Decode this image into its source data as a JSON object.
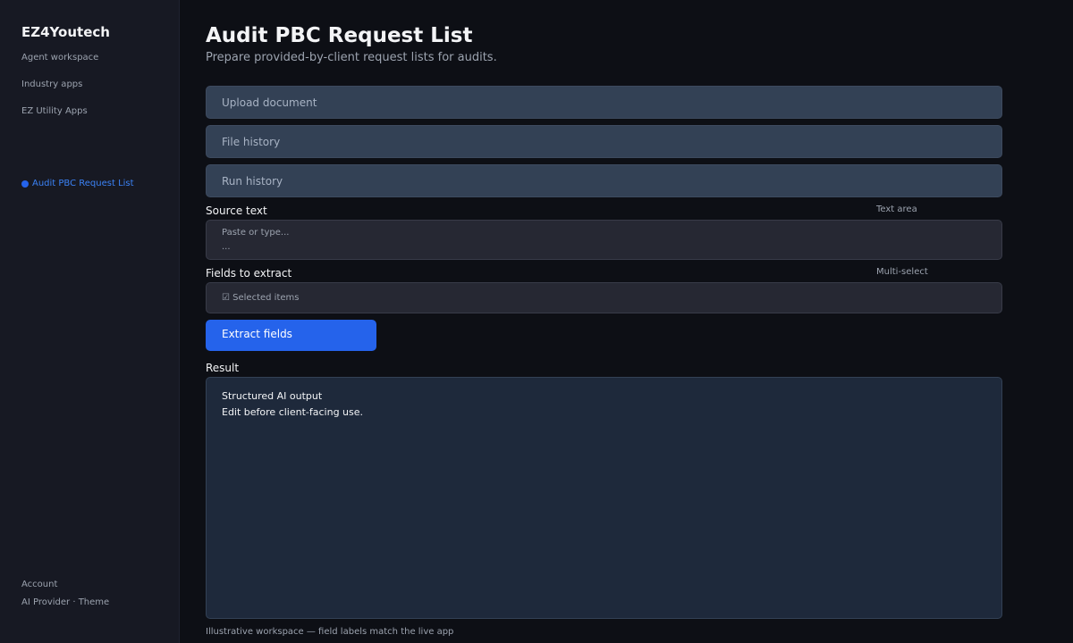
{
  "sidebar": {
    "brand": "EZ4Youtech",
    "nav": [
      {
        "label": "Agent workspace"
      },
      {
        "label": "Industry apps"
      },
      {
        "label": "EZ Utility Apps"
      }
    ],
    "active_item": "Audit PBC Request List",
    "footer": {
      "account": "Account",
      "ai_provider": "AI Provider",
      "separator": " · ",
      "theme": "Theme"
    }
  },
  "main": {
    "title": "Audit PBC Request List",
    "subtitle": "Prepare provided-by-client request lists for audits.",
    "sections": [
      {
        "label": "Upload document"
      },
      {
        "label": "File history"
      },
      {
        "label": "Run history"
      }
    ],
    "source": {
      "label": "Source text",
      "kind": "Text area",
      "placeholder": "Paste or type...",
      "ellipsis": "..."
    },
    "fields": {
      "label": "Fields to extract",
      "kind": "Multi-select",
      "value": "☑ Selected items"
    },
    "extract_button": "Extract fields",
    "result": {
      "label": "Result",
      "line1": "Structured AI output",
      "line2": "Edit before client-facing use."
    },
    "footnote": "Illustrative workspace — field labels match the live app"
  },
  "colors": {
    "accent": "#2563eb",
    "active_link": "#3b82f6",
    "background": "#0d0f15",
    "sidebar": "#171923"
  }
}
